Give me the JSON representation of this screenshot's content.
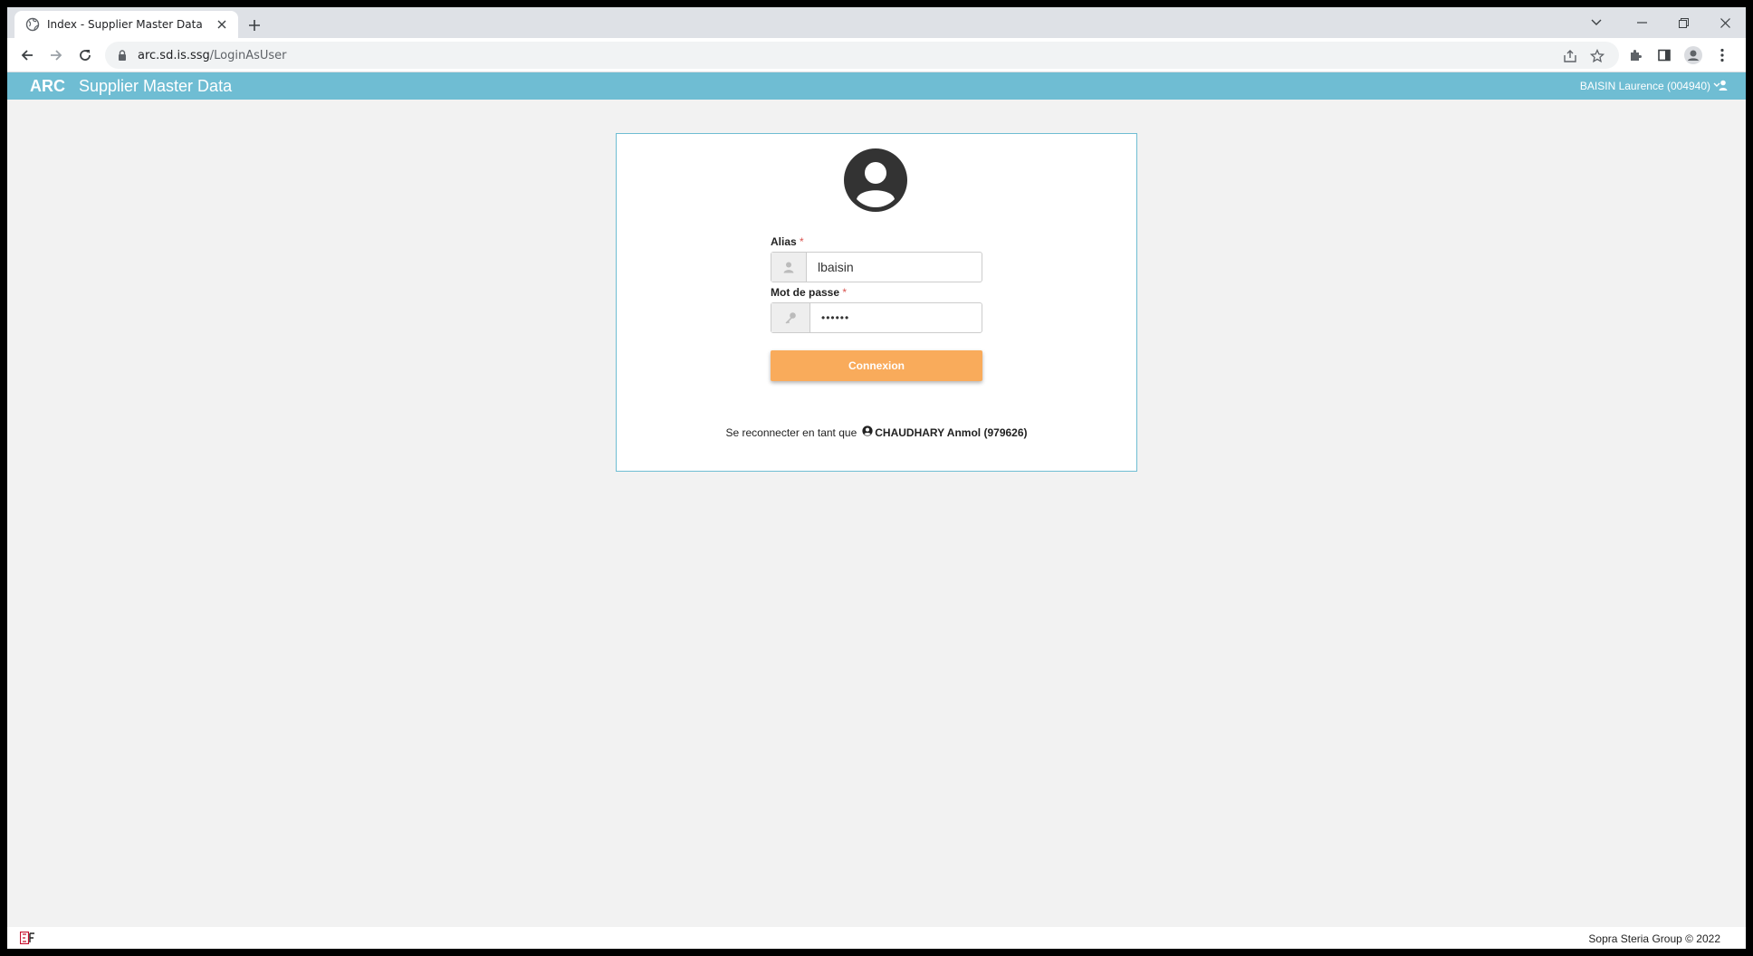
{
  "browser": {
    "tab_title": "Index - Supplier Master Data",
    "url_host": "arc.sd.is.ssg",
    "url_path": "/LoginAsUser"
  },
  "header": {
    "brand": "ARC",
    "title": "Supplier Master Data",
    "user": "BAISIN Laurence (004940)"
  },
  "login": {
    "alias_label": "Alias",
    "alias_value": "lbaisin",
    "password_label": "Mot de passe",
    "password_value": "••••••",
    "required_mark": "*",
    "submit_label": "Connexion",
    "relogin_text": "Se reconnecter en tant que",
    "relogin_user": "CHAUDHARY Anmol (979626)"
  },
  "footer": {
    "copyright": "Sopra Steria Group © 2022"
  },
  "colors": {
    "header_bg": "#6fbdd3",
    "button_bg": "#f9ab5b",
    "page_bg": "#f2f2f2"
  }
}
